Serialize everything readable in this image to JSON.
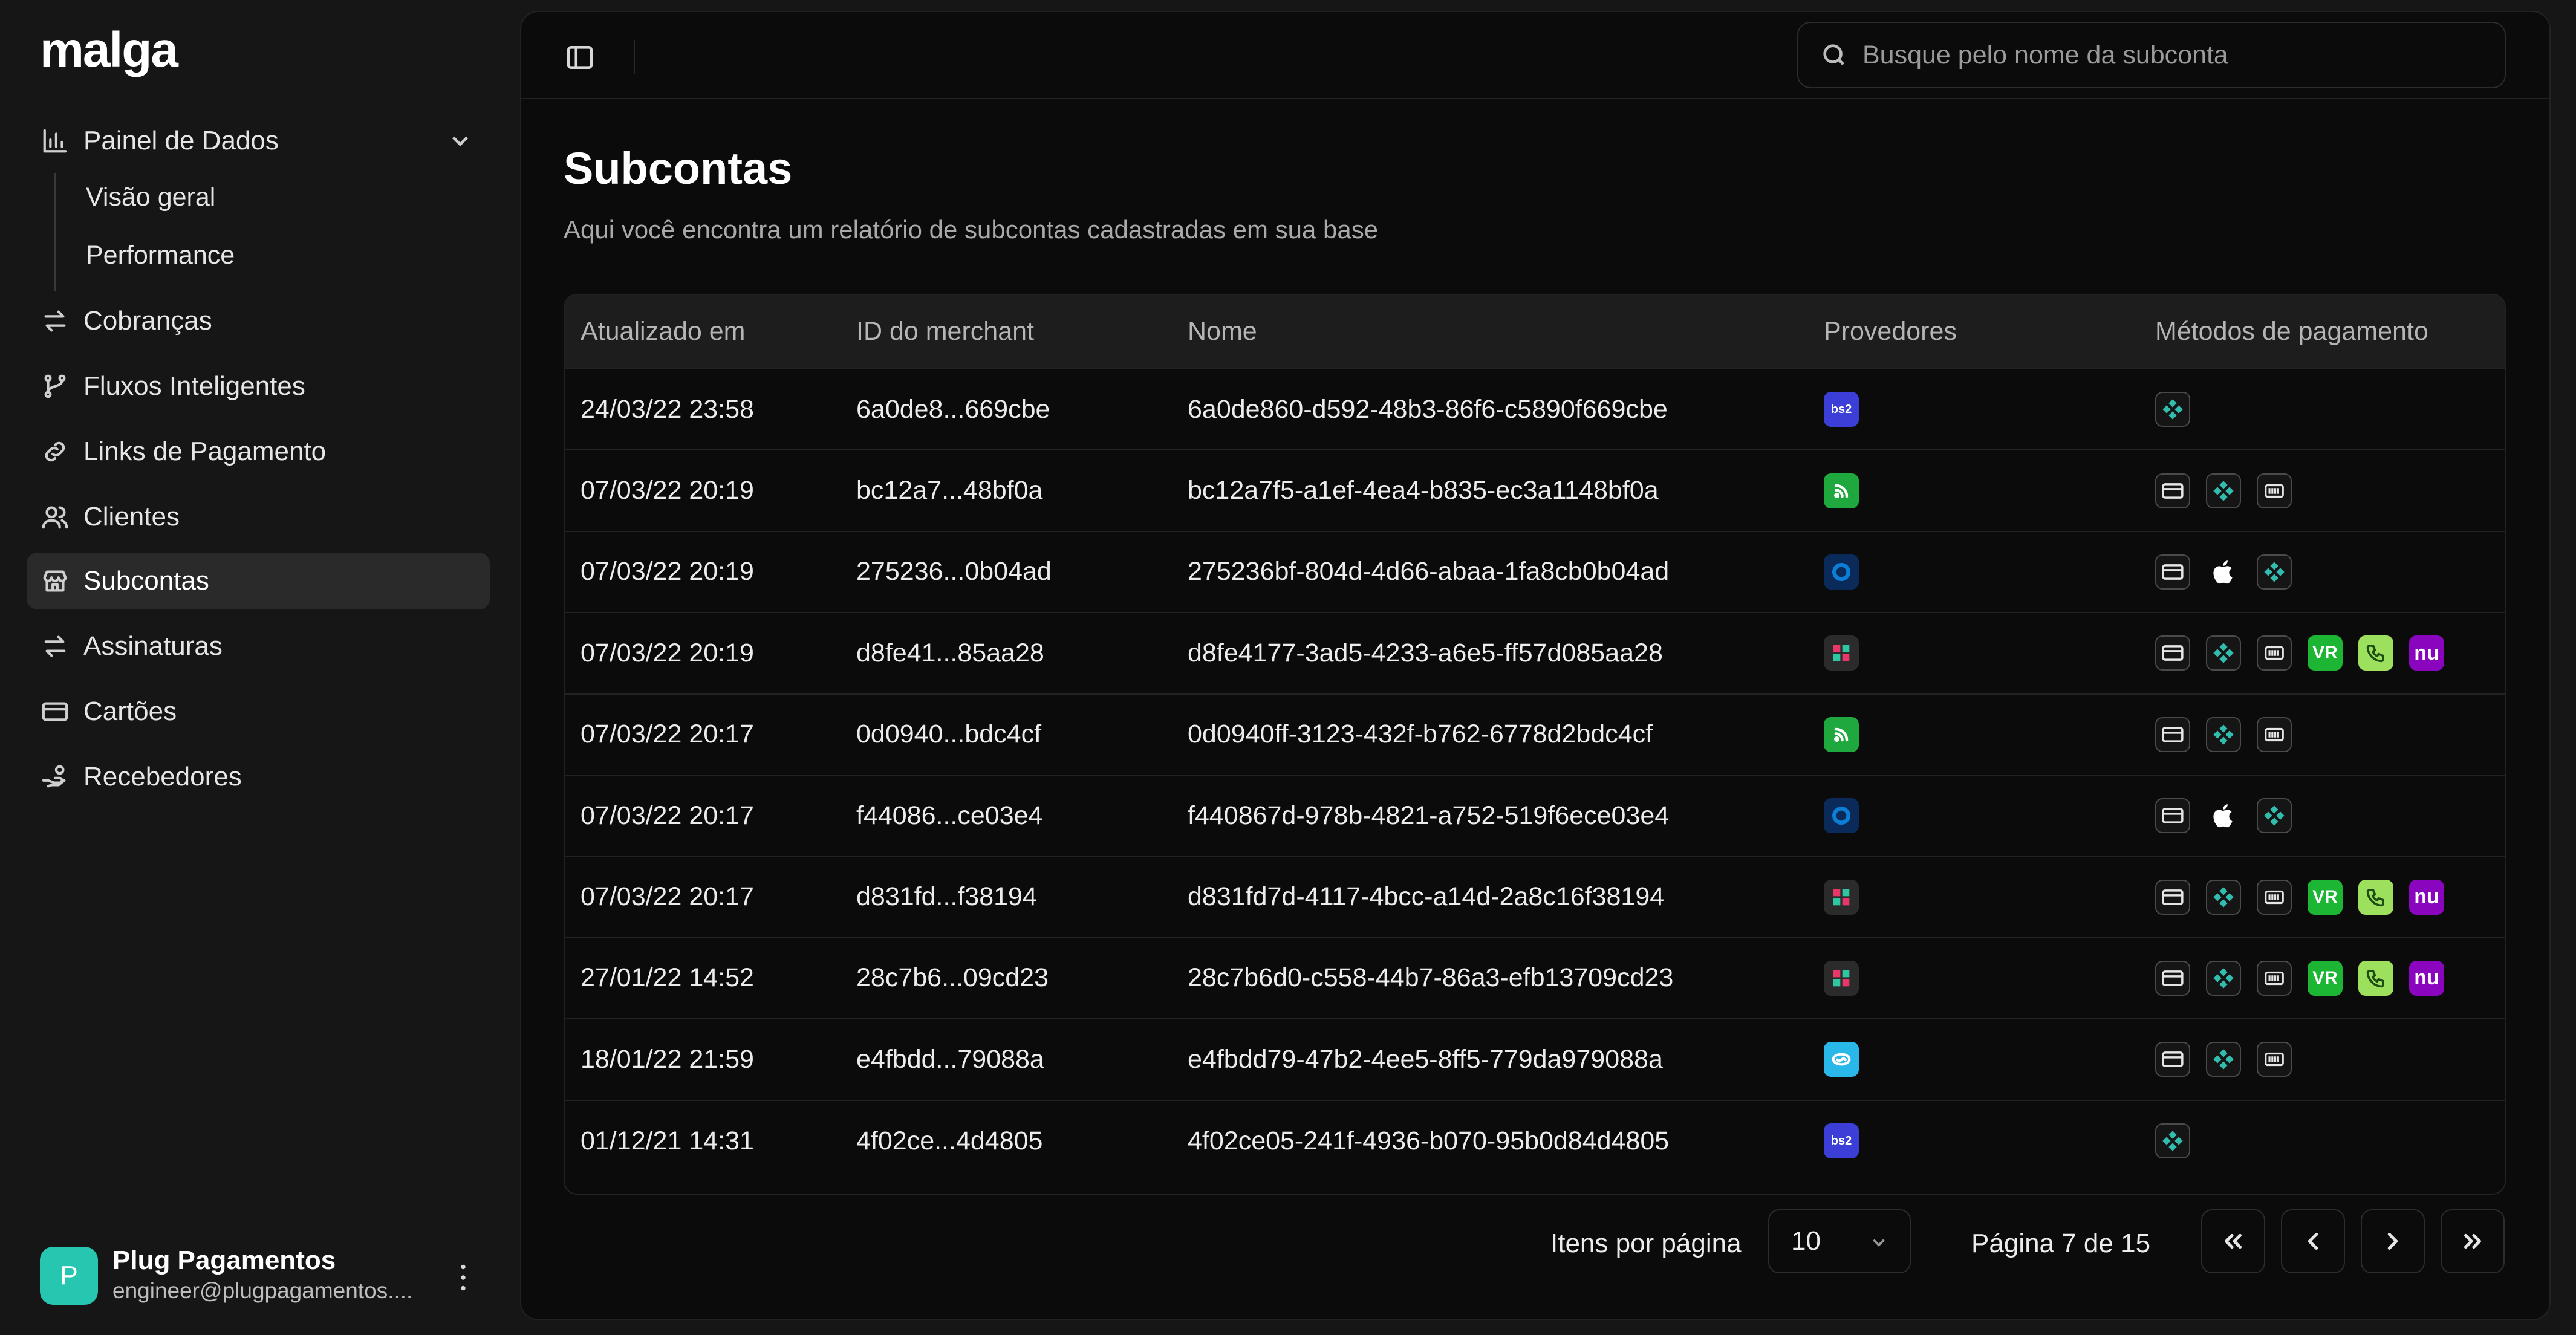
{
  "app": {
    "logo": "malga"
  },
  "search": {
    "placeholder": "Busque pelo nome da subconta"
  },
  "sidebar": {
    "items": [
      {
        "label": "Painel de Dados",
        "icon": "bar-chart-icon"
      },
      {
        "label": "Cobranças",
        "icon": "arrows-exchange-icon"
      },
      {
        "label": "Fluxos Inteligentes",
        "icon": "git-branch-icon"
      },
      {
        "label": "Links de Pagamento",
        "icon": "link-icon"
      },
      {
        "label": "Clientes",
        "icon": "users-icon"
      },
      {
        "label": "Subcontas",
        "icon": "store-icon",
        "active": true
      },
      {
        "label": "Assinaturas",
        "icon": "repeat-icon"
      },
      {
        "label": "Cartões",
        "icon": "credit-card-icon"
      },
      {
        "label": "Recebedores",
        "icon": "hand-coins-icon"
      }
    ],
    "sub_items": [
      {
        "label": "Visão geral"
      },
      {
        "label": "Performance"
      }
    ]
  },
  "account": {
    "initial": "P",
    "name": "Plug Pagamentos",
    "email": "engineer@plugpagamentos...."
  },
  "page": {
    "title": "Subcontas",
    "subtitle": "Aqui você encontra um relatório de subcontas cadastradas em sua base"
  },
  "table": {
    "headers": [
      "Atualizado em",
      "ID do merchant",
      "Nome",
      "Provedores",
      "Métodos de pagamento"
    ],
    "rows": [
      {
        "updated": "24/03/22 23:58",
        "merchant_id": "6a0de8...669cbe",
        "name": "6a0de860-d592-48b3-86f6-c5890f669cbe",
        "provider": "bs2",
        "methods": [
          "pix"
        ]
      },
      {
        "updated": "07/03/22 20:19",
        "merchant_id": "bc12a7...48bf0a",
        "name": "bc12a7f5-a1ef-4ea4-b835-ec3a1148bf0a",
        "provider": "getnet",
        "methods": [
          "card",
          "pix",
          "boleto"
        ]
      },
      {
        "updated": "07/03/22 20:19",
        "merchant_id": "275236...0b04ad",
        "name": "275236bf-804d-4d66-abaa-1fa8cb0b04ad",
        "provider": "cielo",
        "methods": [
          "card",
          "applepay",
          "pix"
        ]
      },
      {
        "updated": "07/03/22 20:19",
        "merchant_id": "d8fe41...85aa28",
        "name": "d8fe4177-3ad5-4233-a6e5-ff57d085aa28",
        "provider": "pagseguro",
        "methods": [
          "card",
          "pix",
          "boleto",
          "vr",
          "phone",
          "nu"
        ]
      },
      {
        "updated": "07/03/22 20:17",
        "merchant_id": "0d0940...bdc4cf",
        "name": "0d0940ff-3123-432f-b762-6778d2bdc4cf",
        "provider": "getnet",
        "methods": [
          "card",
          "pix",
          "boleto"
        ]
      },
      {
        "updated": "07/03/22 20:17",
        "merchant_id": "f44086...ce03e4",
        "name": "f440867d-978b-4821-a752-519f6ece03e4",
        "provider": "cielo",
        "methods": [
          "card",
          "applepay",
          "pix"
        ]
      },
      {
        "updated": "07/03/22 20:17",
        "merchant_id": "d831fd...f38194",
        "name": "d831fd7d-4117-4bcc-a14d-2a8c16f38194",
        "provider": "pagseguro",
        "methods": [
          "card",
          "pix",
          "boleto",
          "vr",
          "phone",
          "nu"
        ]
      },
      {
        "updated": "27/01/22 14:52",
        "merchant_id": "28c7b6...09cd23",
        "name": "28c7b6d0-c558-44b7-86a3-efb13709cd23",
        "provider": "pagseguro",
        "methods": [
          "card",
          "pix",
          "boleto",
          "vr",
          "phone",
          "nu"
        ]
      },
      {
        "updated": "18/01/22 21:59",
        "merchant_id": "e4fbdd...79088a",
        "name": "e4fbdd79-47b2-4ee5-8ff5-779da979088a",
        "provider": "mercadopago",
        "methods": [
          "card",
          "pix",
          "boleto"
        ]
      },
      {
        "updated": "01/12/21 14:31",
        "merchant_id": "4f02ce...4d4805",
        "name": "4f02ce05-241f-4936-b070-95b0d84d4805",
        "provider": "bs2",
        "methods": [
          "pix"
        ]
      }
    ]
  },
  "pagination": {
    "per_page_label": "Itens por página",
    "per_page_value": "10",
    "page_info": "Página 7 de 15"
  },
  "icon_text": {
    "bs2": "bs2",
    "vr": "VR",
    "nu": "nu"
  },
  "colors": {
    "bs2": "#3b3fd8",
    "getnet": "#1fa83e",
    "cielo": "#0d7ed6",
    "pagseguro": "#e8386a",
    "mercadopago": "#2ab7ea",
    "pix": "#32bcad",
    "nubank": "#8a05be",
    "vr": "#1db534",
    "phone": "#9de05e"
  }
}
